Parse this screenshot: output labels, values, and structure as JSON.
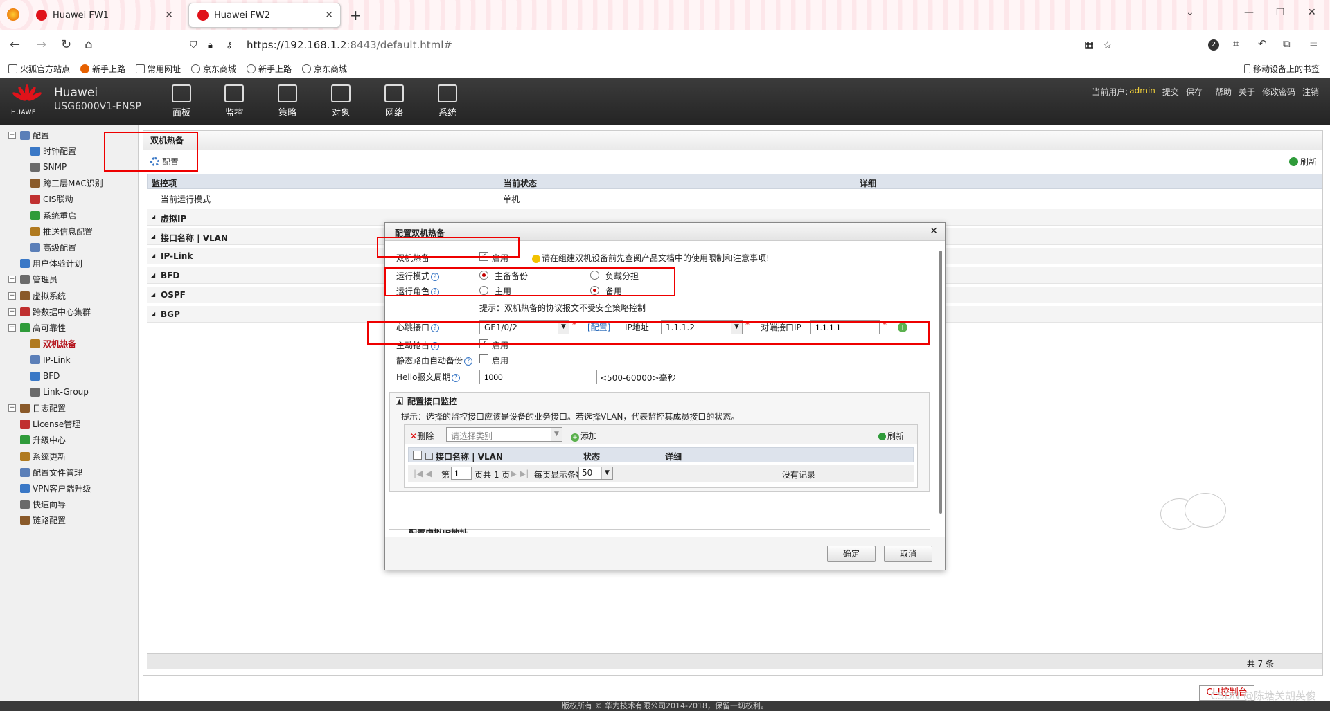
{
  "browser": {
    "tabs": [
      {
        "label": "Huawei FW1",
        "active": false
      },
      {
        "label": "Huawei FW2",
        "active": true
      }
    ],
    "url_host": "https://192.168.1.2",
    "url_rest": ":8443/default.html#",
    "ext_badge": "2",
    "bookmarks": [
      "火狐官方站点",
      "新手上路",
      "常用网址",
      "京东商城",
      "新手上路",
      "京东商城"
    ],
    "mobile_bookmarks": "移动设备上的书签"
  },
  "app": {
    "brand_line1": "Huawei",
    "brand_line2": "USG6000V1-ENSP",
    "logo_text": "HUAWEI",
    "menu": [
      "面板",
      "监控",
      "策略",
      "对象",
      "网络",
      "系统"
    ],
    "user_label": "当前用户:",
    "user_name": "admin",
    "user_actions": [
      "提交",
      "保存",
      "帮助",
      "关于",
      "修改密码",
      "注销"
    ]
  },
  "sidebar": {
    "items": [
      {
        "label": "配置",
        "level": 0,
        "expand": "−"
      },
      {
        "label": "时钟配置",
        "level": 1
      },
      {
        "label": "SNMP",
        "level": 1
      },
      {
        "label": "跨三层MAC识别",
        "level": 1
      },
      {
        "label": "CIS联动",
        "level": 1
      },
      {
        "label": "系统重启",
        "level": 1
      },
      {
        "label": "推送信息配置",
        "level": 1
      },
      {
        "label": "高级配置",
        "level": 1
      },
      {
        "label": "用户体验计划",
        "level": 0
      },
      {
        "label": "管理员",
        "level": 0,
        "expand": "+"
      },
      {
        "label": "虚拟系统",
        "level": 0,
        "expand": "+"
      },
      {
        "label": "跨数据中心集群",
        "level": 0,
        "expand": "+"
      },
      {
        "label": "高可靠性",
        "level": 0,
        "expand": "−"
      },
      {
        "label": "双机热备",
        "level": 1,
        "selected": true
      },
      {
        "label": "IP-Link",
        "level": 1
      },
      {
        "label": "BFD",
        "level": 1
      },
      {
        "label": "Link-Group",
        "level": 1
      },
      {
        "label": "日志配置",
        "level": 0,
        "expand": "+"
      },
      {
        "label": "License管理",
        "level": 0
      },
      {
        "label": "升级中心",
        "level": 0
      },
      {
        "label": "系统更新",
        "level": 0
      },
      {
        "label": "配置文件管理",
        "level": 0
      },
      {
        "label": "VPN客户端升级",
        "level": 0
      },
      {
        "label": "快速向导",
        "level": 0
      },
      {
        "label": "链路配置",
        "level": 0
      }
    ]
  },
  "main": {
    "title": "双机热备",
    "config_button": "配置",
    "refresh_button": "刷新",
    "columns": [
      "监控项",
      "当前状态",
      "详细"
    ],
    "rows": [
      {
        "label": "当前运行模式",
        "status": "单机",
        "group": false
      },
      {
        "label": "虚拟IP",
        "group": true
      },
      {
        "label": "接口名称 | VLAN",
        "group": true
      },
      {
        "label": "IP-Link",
        "group": true
      },
      {
        "label": "BFD",
        "group": true
      },
      {
        "label": "OSPF",
        "group": true
      },
      {
        "label": "BGP",
        "group": true
      }
    ],
    "total": "共 7 条"
  },
  "dialog": {
    "title": "配置双机热备",
    "hot_standby_label": "双机热备",
    "enable_label": "启用",
    "warning": "请在组建双机设备前先查阅产品文档中的使用限制和注意事项!",
    "run_mode_label": "运行模式",
    "mode_options": [
      "主备备份",
      "负载分担"
    ],
    "run_role_label": "运行角色",
    "role_options": [
      "主用",
      "备用"
    ],
    "hint": "提示：双机热备的协议报文不受安全策略控制",
    "heartbeat_label": "心跳接口",
    "heartbeat_value": "GE1/0/2",
    "config_link": "[配置]",
    "ip_label": "IP地址",
    "ip_value": "1.1.1.2",
    "peer_ip_label": "对端接口IP",
    "peer_ip_value": "1.1.1.1",
    "preempt_label": "主动抢占",
    "static_route_label": "静态路由自动备份",
    "hello_label": "Hello报文周期",
    "hello_value": "1000",
    "hello_range": "<500-60000>毫秒",
    "monitor_section": {
      "title": "配置接口监控",
      "hint": "提示：选择的监控接口应该是设备的业务接口。若选择VLAN，代表监控其成员接口的状态。",
      "delete": "删除",
      "category_placeholder": "请选择类别",
      "add": "添加",
      "refresh": "刷新",
      "columns": [
        "接口名称 | VLAN",
        "状态",
        "详细"
      ],
      "page_prefix": "第",
      "page_value": "1",
      "page_suffix": "页共 1 页",
      "page_size_label": "每页显示条数",
      "page_size_value": "50",
      "no_records": "没有记录"
    },
    "next_section": "配置虚拟IP地址",
    "ok": "确定",
    "cancel": "取消"
  },
  "footer": {
    "copyright": "版权所有 © 华为技术有限公司2014-2018，保留一切权利。",
    "cli": "CLI控制台",
    "watermark": "CSDN @陈塘关胡英俊"
  },
  "colors": {
    "header_bg": "#2e2e2e",
    "accent_red": "#e00000",
    "selected_tree": "#b4121a",
    "user_yellow": "#f3d23b"
  }
}
